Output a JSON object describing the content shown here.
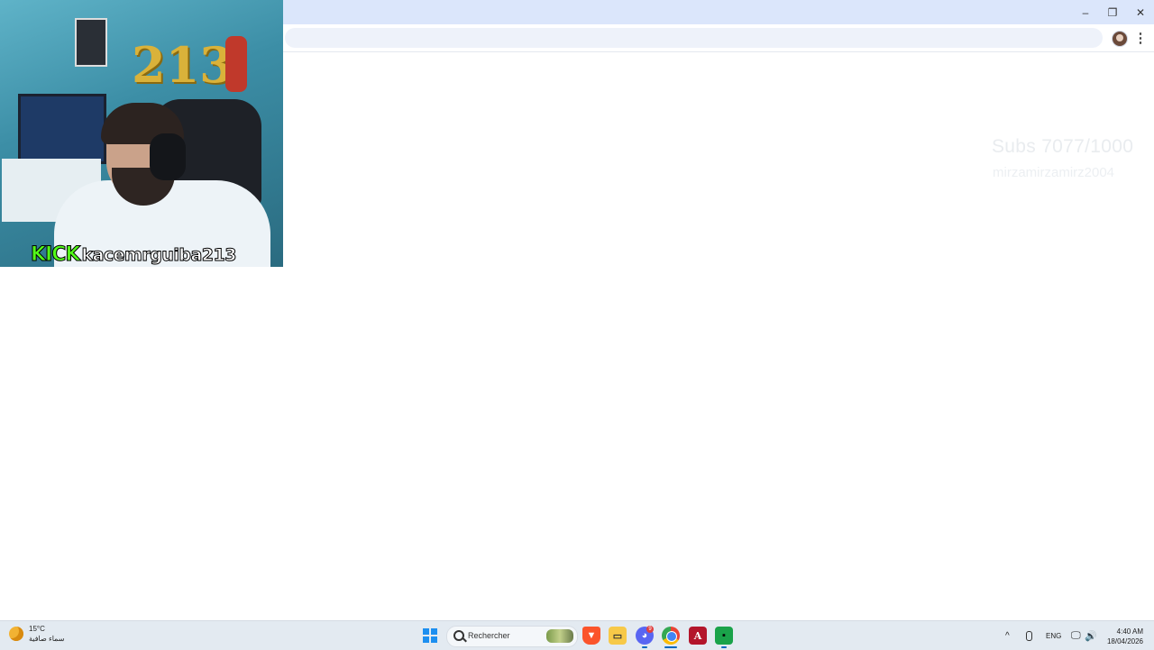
{
  "overlay": {
    "subs_text": "Subs 7077/1000",
    "username_text": "mirzamirzamirz2004"
  },
  "webcam": {
    "platform": "KICK",
    "channel": "kacemrguiba213",
    "balloons": "213"
  },
  "browser": {
    "minimize": "–",
    "maximize": "❐",
    "close": "✕",
    "menu": "⋮"
  },
  "taskbar": {
    "weather": {
      "temp": "15°C",
      "condition": "سماء صافية"
    },
    "search_placeholder": "Rechercher",
    "discord_badge": "9",
    "tray": {
      "chevron": "^",
      "language": "ENG",
      "network": "🖵",
      "volume": "🔊"
    },
    "clock": {
      "time": "4:40 AM",
      "date": "18/04/2026"
    }
  },
  "colors": {
    "titlebar": "#dbe6fb",
    "kick_green": "#53fc18",
    "taskbar": "#e3eaf1"
  }
}
